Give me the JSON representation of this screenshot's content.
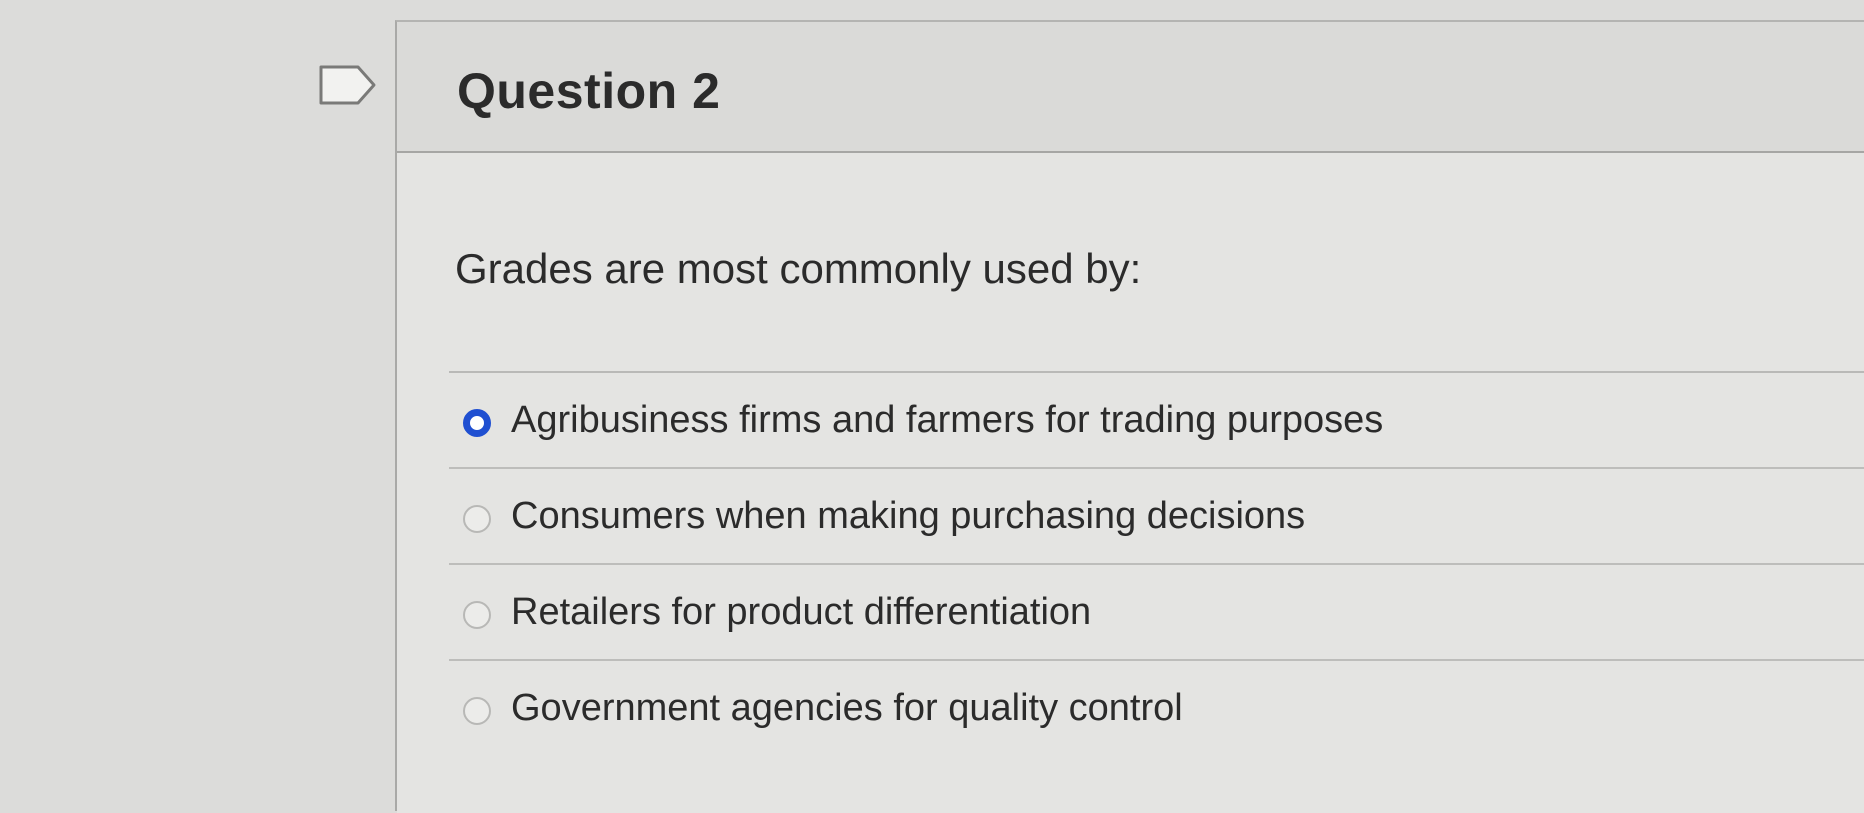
{
  "question": {
    "title": "Question 2",
    "text": "Grades are most commonly used by:"
  },
  "answers": [
    {
      "label": "Agribusiness firms and farmers for trading purposes",
      "selected": true
    },
    {
      "label": "Consumers when making purchasing decisions",
      "selected": false
    },
    {
      "label": "Retailers for product differentiation",
      "selected": false
    },
    {
      "label": "Government agencies for quality control",
      "selected": false
    }
  ],
  "icons": {
    "flag": "flag-icon"
  },
  "colors": {
    "selected_radio": "#1f4fd1",
    "text": "#2b2b2b",
    "background": "#e4e4e2"
  }
}
